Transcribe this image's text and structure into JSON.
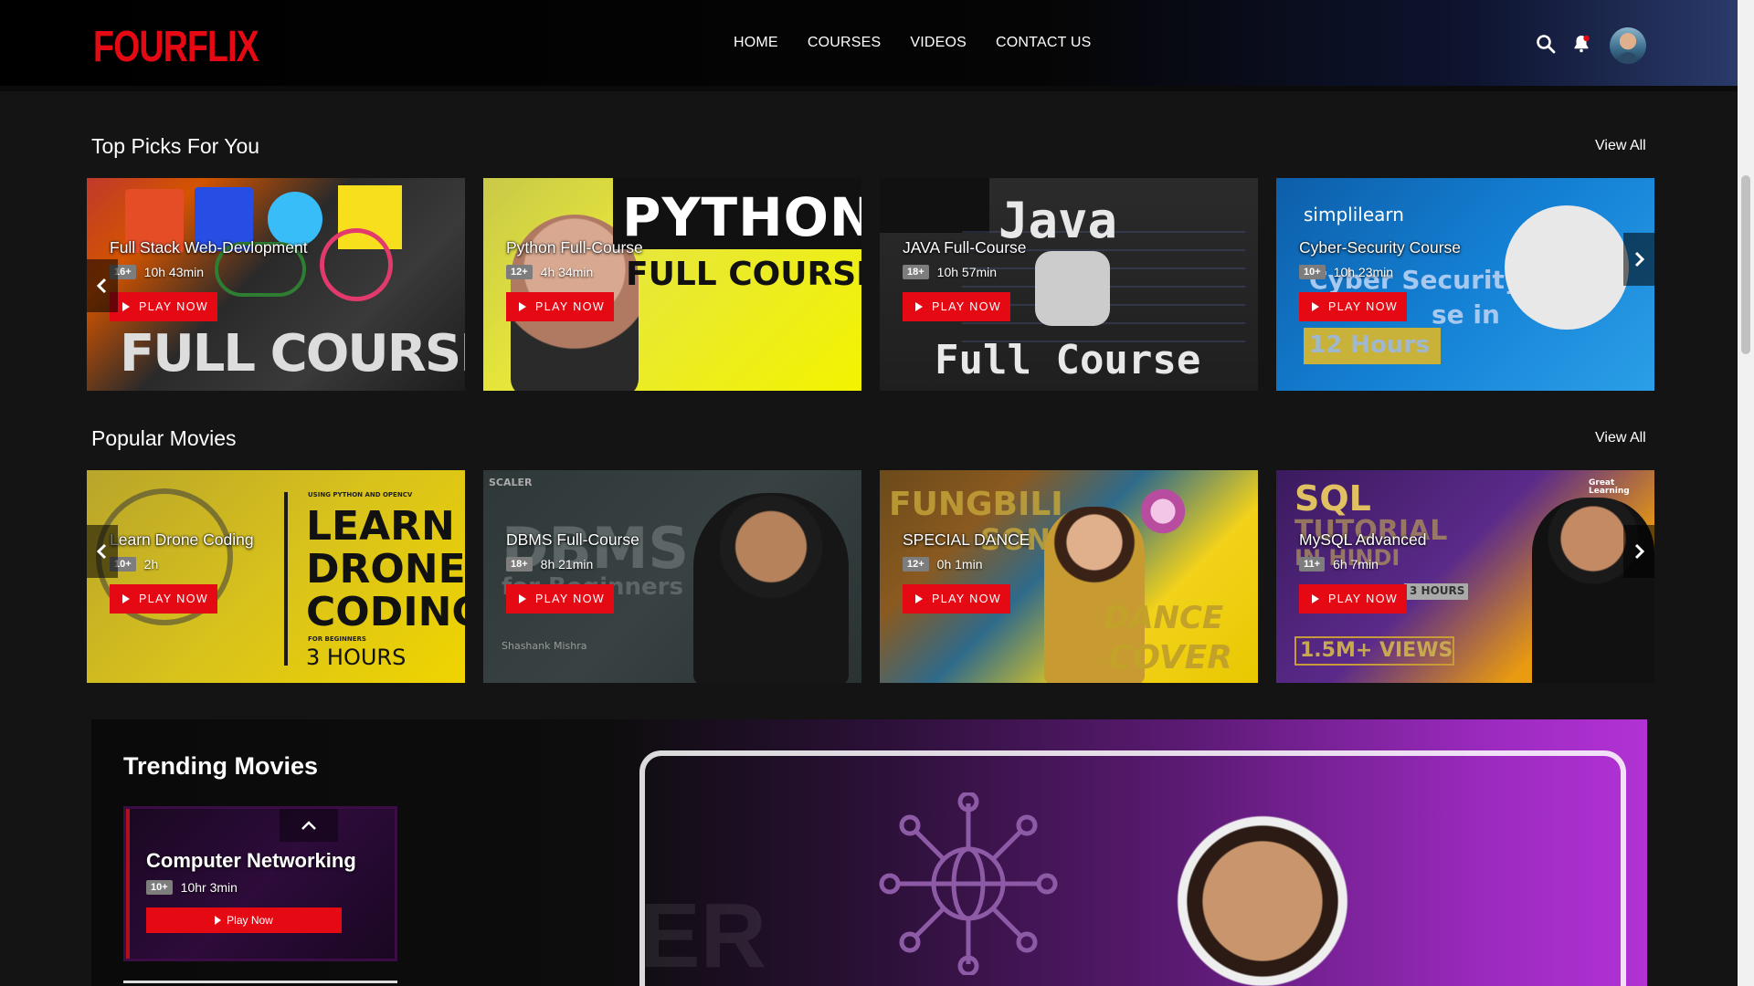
{
  "header": {
    "logo": "FOURFLIX",
    "nav": [
      "HOME",
      "COURSES",
      "VIDEOS",
      "CONTACT US"
    ]
  },
  "sections": [
    {
      "title": "Top Picks For You",
      "view_all": "View All",
      "cards": [
        {
          "title": "Full Stack Web-Devlopment",
          "age": "16+",
          "duration": "10h 43min",
          "play": "PLAY NOW",
          "thumb_text": "FULL COURSE"
        },
        {
          "title": "Python Full-Course",
          "age": "12+",
          "duration": "4h 34min",
          "play": "PLAY NOW",
          "thumb_text_1": "PYTHON",
          "thumb_text_2": "FULL COURSE"
        },
        {
          "title": "JAVA Full-Course",
          "age": "18+",
          "duration": "10h 57min",
          "play": "PLAY NOW",
          "thumb_text_1": "Java",
          "thumb_text_2": "Full Course"
        },
        {
          "title": "Cyber-Security Course",
          "age": "10+",
          "duration": "10h 23min",
          "play": "PLAY NOW",
          "thumb_brand": "simplilearn",
          "thumb_text_1": "Cyber Security",
          "thumb_text_2": "se in",
          "thumb_text_3": "12 Hours"
        }
      ]
    },
    {
      "title": "Popular Movies",
      "view_all": "View All",
      "cards": [
        {
          "title": "Learn Drone Coding",
          "age": "10+",
          "duration": "2h",
          "play": "PLAY NOW",
          "thumb_small": "USING PYTHON AND OPENCV",
          "thumb_text_1": "LEARN",
          "thumb_text_2": "DRONE",
          "thumb_text_3": "CODING",
          "thumb_small_2": "FOR BEGINNERS",
          "thumb_text_4": "3 HOURS"
        },
        {
          "title": "DBMS Full-Course",
          "age": "18+",
          "duration": "8h 21min",
          "play": "PLAY NOW",
          "thumb_brand": "SCALER",
          "thumb_text_1": "DBMS",
          "thumb_text_2": "for Beginners",
          "thumb_name": "Shashank Mishra"
        },
        {
          "title": "SPECIAL DANCE",
          "age": "12+",
          "duration": "0h 1min",
          "play": "PLAY NOW",
          "thumb_text_1": "FUNGBILI",
          "thumb_text_2": "SONG",
          "thumb_text_3": "DANCE",
          "thumb_text_4": "COVER"
        },
        {
          "title": "MySQL Advanced",
          "age": "11+",
          "duration": "6h 7min",
          "play": "PLAY NOW",
          "thumb_brand": "Great Learning",
          "thumb_text_1": "SQL",
          "thumb_text_2": "TUTORIAL",
          "thumb_text_3": "IN HINDI",
          "thumb_text_4": "3 HOURS",
          "thumb_text_5": "1.5M+ VIEWS"
        }
      ]
    }
  ],
  "trending": {
    "title": "Trending Movies",
    "card": {
      "title": "Computer Networking",
      "age": "10+",
      "duration": "10hr 3min",
      "play": "Play Now"
    },
    "hero_text": "ER"
  }
}
